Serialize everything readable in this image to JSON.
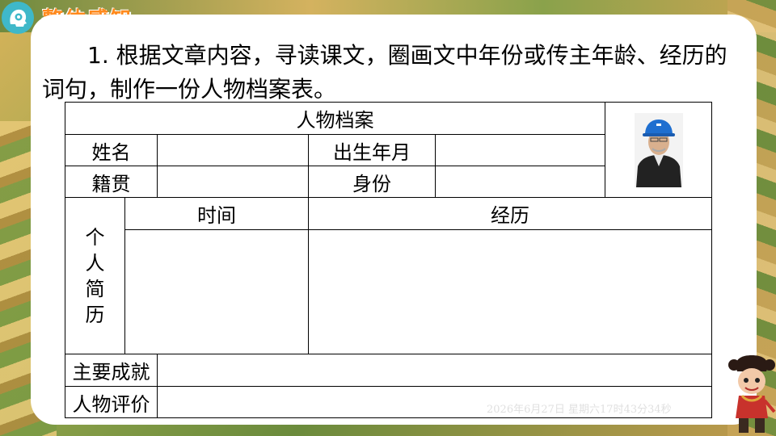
{
  "header": {
    "section_title": "整体感知",
    "logo_icon": "gear-head-icon"
  },
  "instruction": "1. 根据文章内容，寻读课文，圈画文中年份或传主年龄、经历的词句，制作一份人物档案表。",
  "table": {
    "title": "人物档案",
    "name_label": "姓名",
    "birth_label": "出生年月",
    "hometown_label": "籍贯",
    "identity_label": "身份",
    "profile_label_chars": [
      "个",
      "人",
      "简",
      "历"
    ],
    "time_header": "时间",
    "experience_header": "经历",
    "achievement_label": "主要成就",
    "evaluation_label": "人物评价",
    "photo_icon": "portrait-hard-hat-man"
  },
  "timestamp": "2026年6月27日 星期六17时43分34秒",
  "colors": {
    "title_orange": "#ff8a1e",
    "logo_teal": "#3fb8c9",
    "helmet_blue": "#1f6fd0"
  }
}
